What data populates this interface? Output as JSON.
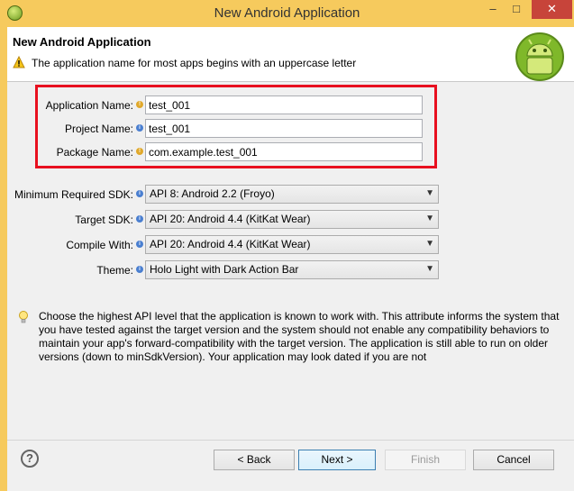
{
  "window": {
    "title": "New Android Application"
  },
  "header": {
    "title": "New Android Application",
    "message": "The application name for most apps begins with an uppercase letter"
  },
  "fields": {
    "app_name": {
      "label": "Application Name:",
      "value": "test_001"
    },
    "project_name": {
      "label": "Project Name:",
      "value": "test_001"
    },
    "package_name": {
      "label": "Package Name:",
      "value": "com.example.test_001"
    }
  },
  "selects": {
    "min_sdk": {
      "label": "Minimum Required SDK:",
      "value": "API 8: Android 2.2 (Froyo)"
    },
    "target_sdk": {
      "label": "Target SDK:",
      "value": "API 20: Android 4.4 (KitKat Wear)"
    },
    "compile_with": {
      "label": "Compile With:",
      "value": "API 20: Android 4.4 (KitKat Wear)"
    },
    "theme": {
      "label": "Theme:",
      "value": "Holo Light with Dark Action Bar"
    }
  },
  "description": "Choose the highest API level that the application is known to work with. This attribute informs the system that you have tested against the target version and the system should not enable any compatibility behaviors to maintain your app's forward-compatibility with the target version. The application is still able to run on older versions (down to minSdkVersion). Your application may look dated if you are not",
  "buttons": {
    "back": "< Back",
    "next": "Next >",
    "finish": "Finish",
    "cancel": "Cancel"
  },
  "colors": {
    "titlebar": "#f6ca5d",
    "highlight": "#e8101f",
    "close": "#c7443a"
  },
  "icons": {
    "app": "android-eclipse-icon",
    "warning": "warning-icon",
    "logo": "android-logo-icon",
    "hint": "lightbulb-icon",
    "help": "help-icon"
  }
}
